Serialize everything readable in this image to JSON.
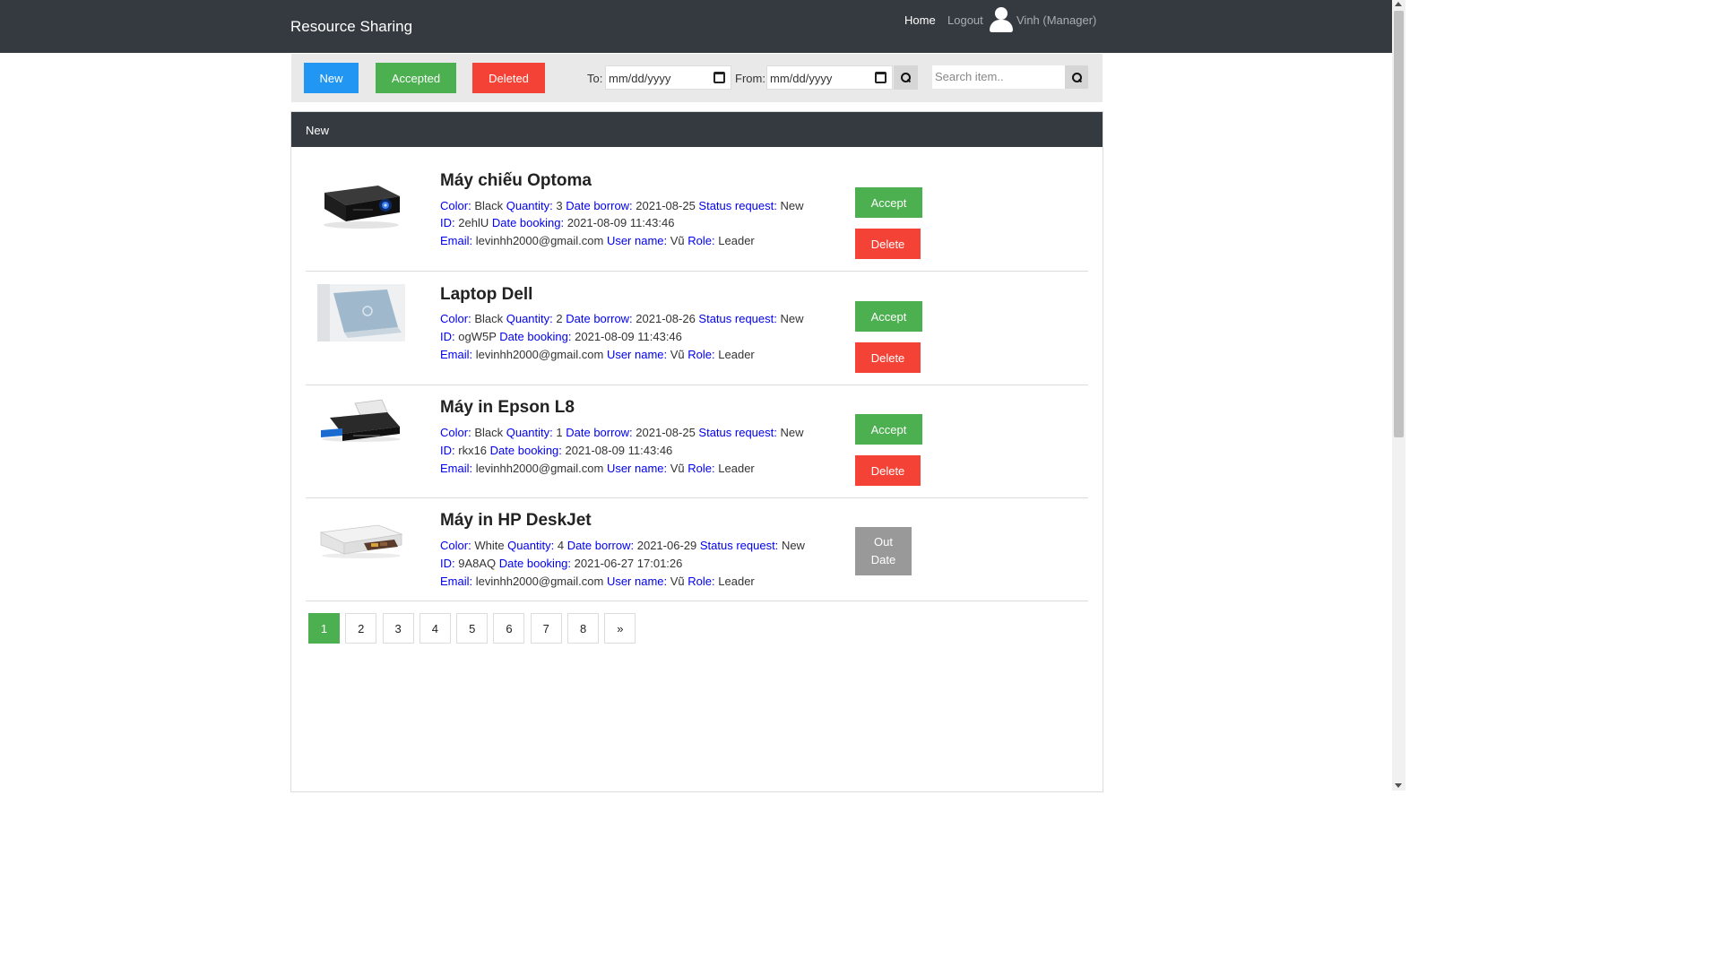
{
  "nav": {
    "brand": "Resource Sharing",
    "home": "Home",
    "logout": "Logout",
    "user": "Vinh (Manager)"
  },
  "toolbar": {
    "new": "New",
    "accepted": "Accepted",
    "deleted": "Deleted",
    "to_label": "To:",
    "from_label": "From:",
    "to_value": "mm/dd/yyyy",
    "from_value": "mm/dd/yyyy",
    "search_placeholder": "Search item.."
  },
  "panel": {
    "title": "New"
  },
  "labels": {
    "color": "Color:",
    "quantity": "Quantity:",
    "date_borrow": "Date borrow:",
    "status": "Status request:",
    "id": "ID:",
    "date_booking": "Date booking:",
    "email": "Email:",
    "user_name": "User name:",
    "role": "Role:",
    "accept": "Accept",
    "delete": "Delete",
    "out": "Out",
    "date": "Date"
  },
  "items": [
    {
      "title": "Máy chiếu Optoma",
      "color": "Black",
      "quantity": "3",
      "date_borrow": "2021-08-25",
      "status": "New",
      "id": "2ehlU",
      "date_booking": "2021-08-09 11:43:46",
      "email": "levinhh2000@gmail.com",
      "user_name": "Vũ",
      "role": "Leader"
    },
    {
      "title": "Laptop Dell",
      "color": "Black",
      "quantity": "2",
      "date_borrow": "2021-08-26",
      "status": "New",
      "id": "ogW5P",
      "date_booking": "2021-08-09 11:43:46",
      "email": "levinhh2000@gmail.com",
      "user_name": "Vũ",
      "role": "Leader"
    },
    {
      "title": "Máy in Epson L8",
      "color": "Black",
      "quantity": "1",
      "date_borrow": "2021-08-25",
      "status": "New",
      "id": "rkx16",
      "date_booking": "2021-08-09 11:43:46",
      "email": "levinhh2000@gmail.com",
      "user_name": "Vũ",
      "role": "Leader"
    },
    {
      "title": "Máy in HP DeskJet",
      "color": "White",
      "quantity": "4",
      "date_borrow": "2021-06-29",
      "status": "New",
      "id": "9A8AQ",
      "date_booking": "2021-06-27 17:01:26",
      "email": "levinhh2000@gmail.com",
      "user_name": "Vũ",
      "role": "Leader"
    }
  ],
  "pagination": [
    "1",
    "2",
    "3",
    "4",
    "5",
    "6",
    "7",
    "8",
    "»"
  ],
  "colors": {
    "navbar": "#343a40",
    "new": "#2196f3",
    "accept": "#4caf50",
    "delete": "#f44336",
    "outdate": "#999999",
    "key_text": "#0000ee"
  }
}
